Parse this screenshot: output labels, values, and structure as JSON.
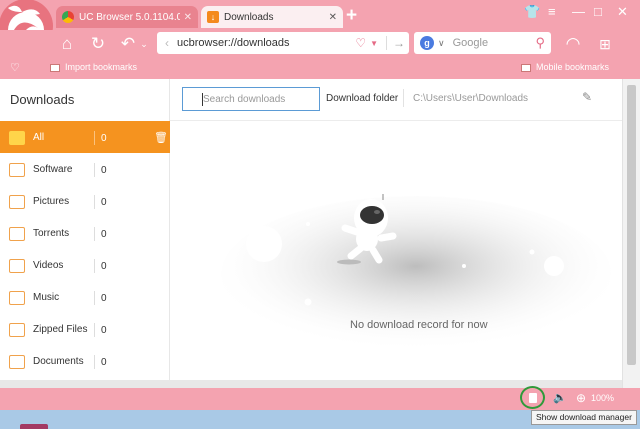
{
  "window": {
    "minimize_glyph": "—",
    "maximize_glyph": "□",
    "close_glyph": "✕"
  },
  "tabs": [
    {
      "title": "UC Browser 5.0.1104.0 - Th",
      "close_glyph": "✕",
      "favicon": "chrome-icon"
    },
    {
      "title": "Downloads",
      "close_glyph": "✕",
      "favicon": "download-icon"
    }
  ],
  "new_tab_glyph": "+",
  "nav": {
    "address_url": "ucbrowser://downloads",
    "search_placeholder": "Google",
    "search_engine_letter": "g"
  },
  "bookmarks": {
    "import_label": "Import bookmarks",
    "mobile_label": "Mobile bookmarks"
  },
  "downloads": {
    "title": "Downloads",
    "search_placeholder": "Search downloads",
    "folder_label": "Download folder",
    "folder_path": "C:\\Users\\User\\Downloads",
    "empty_message": "No download record for now",
    "categories": [
      {
        "label": "All",
        "count": "0",
        "icon": "folder-icon",
        "active": true
      },
      {
        "label": "Software",
        "count": "0",
        "icon": "software-icon"
      },
      {
        "label": "Pictures",
        "count": "0",
        "icon": "picture-icon"
      },
      {
        "label": "Torrents",
        "count": "0",
        "icon": "torrent-icon"
      },
      {
        "label": "Videos",
        "count": "0",
        "icon": "video-icon"
      },
      {
        "label": "Music",
        "count": "0",
        "icon": "music-icon"
      },
      {
        "label": "Zipped Files",
        "count": "0",
        "icon": "zip-icon"
      },
      {
        "label": "Documents",
        "count": "0",
        "icon": "document-icon"
      }
    ]
  },
  "status": {
    "zoom": "100%",
    "tooltip": "Show download manager"
  },
  "colors": {
    "theme_pink": "#f4a3b0",
    "active_orange": "#f5931f",
    "folder_yellow": "#ffd54a",
    "highlight_green": "#2f9a3a"
  }
}
